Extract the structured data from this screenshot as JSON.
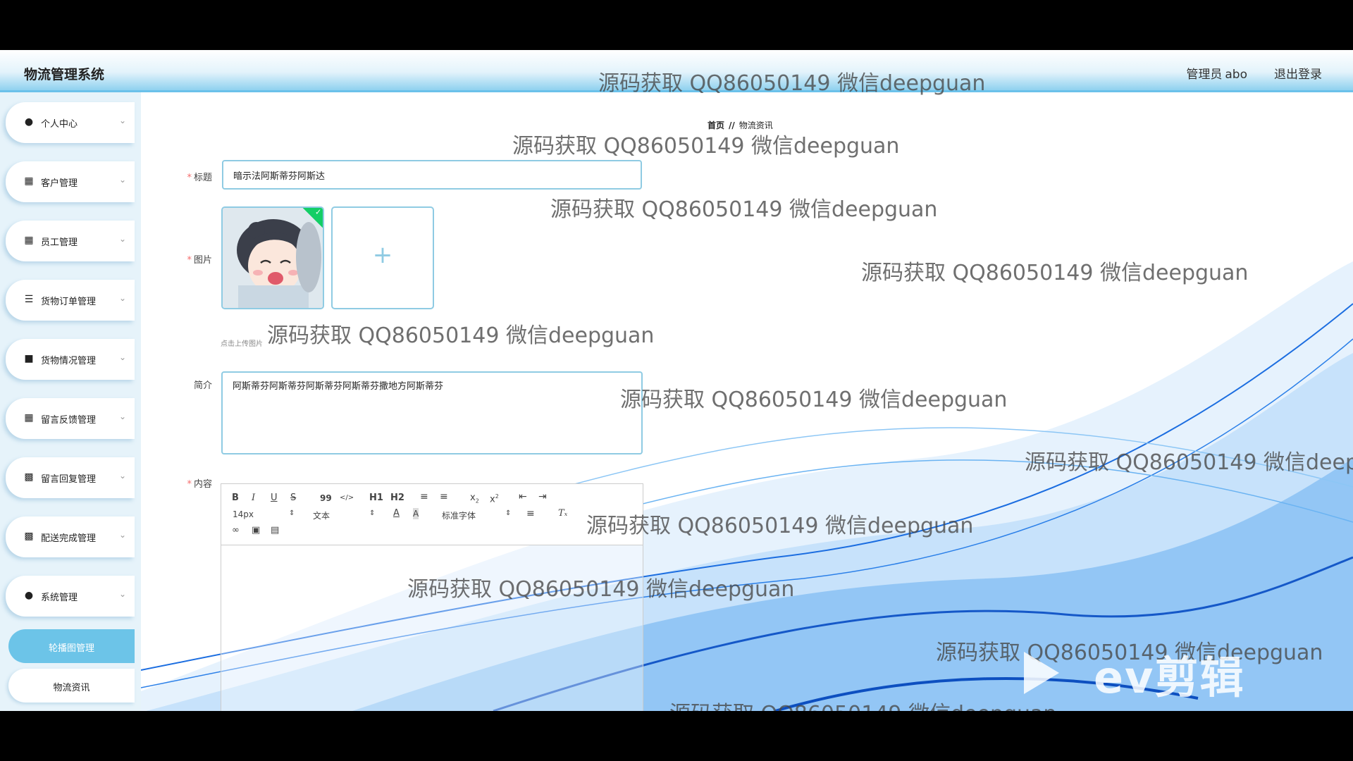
{
  "header": {
    "app_title": "物流管理系统",
    "user_role": "管理员",
    "user_name": "abo",
    "logout": "退出登录"
  },
  "sidebar": {
    "items": [
      {
        "label": "个人中心",
        "icon": "user-icon"
      },
      {
        "label": "客户管理",
        "icon": "grid-icon"
      },
      {
        "label": "员工管理",
        "icon": "grid-icon"
      },
      {
        "label": "货物订单管理",
        "icon": "list-icon"
      },
      {
        "label": "货物情况管理",
        "icon": "briefcase-icon"
      },
      {
        "label": "留言反馈管理",
        "icon": "grid-icon"
      },
      {
        "label": "留言回复管理",
        "icon": "clipboard-icon"
      },
      {
        "label": "配送完成管理",
        "icon": "clipboard-icon"
      },
      {
        "label": "系统管理",
        "icon": "user-icon"
      }
    ],
    "sub_items": [
      {
        "label": "轮播图管理",
        "active": true
      },
      {
        "label": "物流资讯",
        "active": false
      }
    ]
  },
  "breadcrumb": {
    "home": "首页",
    "separator": "//",
    "current": "物流资讯"
  },
  "form": {
    "title_label": "标题",
    "title_value": "暗示法阿斯蒂芬阿斯达",
    "image_label": "图片",
    "upload_icon": "plus-icon",
    "upload_tip": "点击上传图片",
    "intro_label": "简介",
    "intro_value": "阿斯蒂芬阿斯蒂芬阿斯蒂芬阿斯蒂芬撒地方阿斯蒂芬",
    "content_label": "内容",
    "required_mark": "*"
  },
  "editor": {
    "toolbar_row1": [
      "B",
      "I",
      "U",
      "S",
      "99",
      "</>",
      "H1",
      "H2",
      "ol",
      "ul",
      "x2",
      "x2",
      "outdent",
      "indent"
    ],
    "font_size": "14px",
    "text_type": "文本",
    "font_family": "标准字体",
    "row3_icons": [
      "link-icon",
      "image-icon",
      "video-icon"
    ]
  },
  "watermark_text": "源码获取 QQ86050149 微信deepguan",
  "brand_watermark": "ev剪辑",
  "colors": {
    "accent": "#6cc4e8",
    "border": "#8fcbe3",
    "required": "#f56c6c",
    "success": "#13ce66"
  }
}
